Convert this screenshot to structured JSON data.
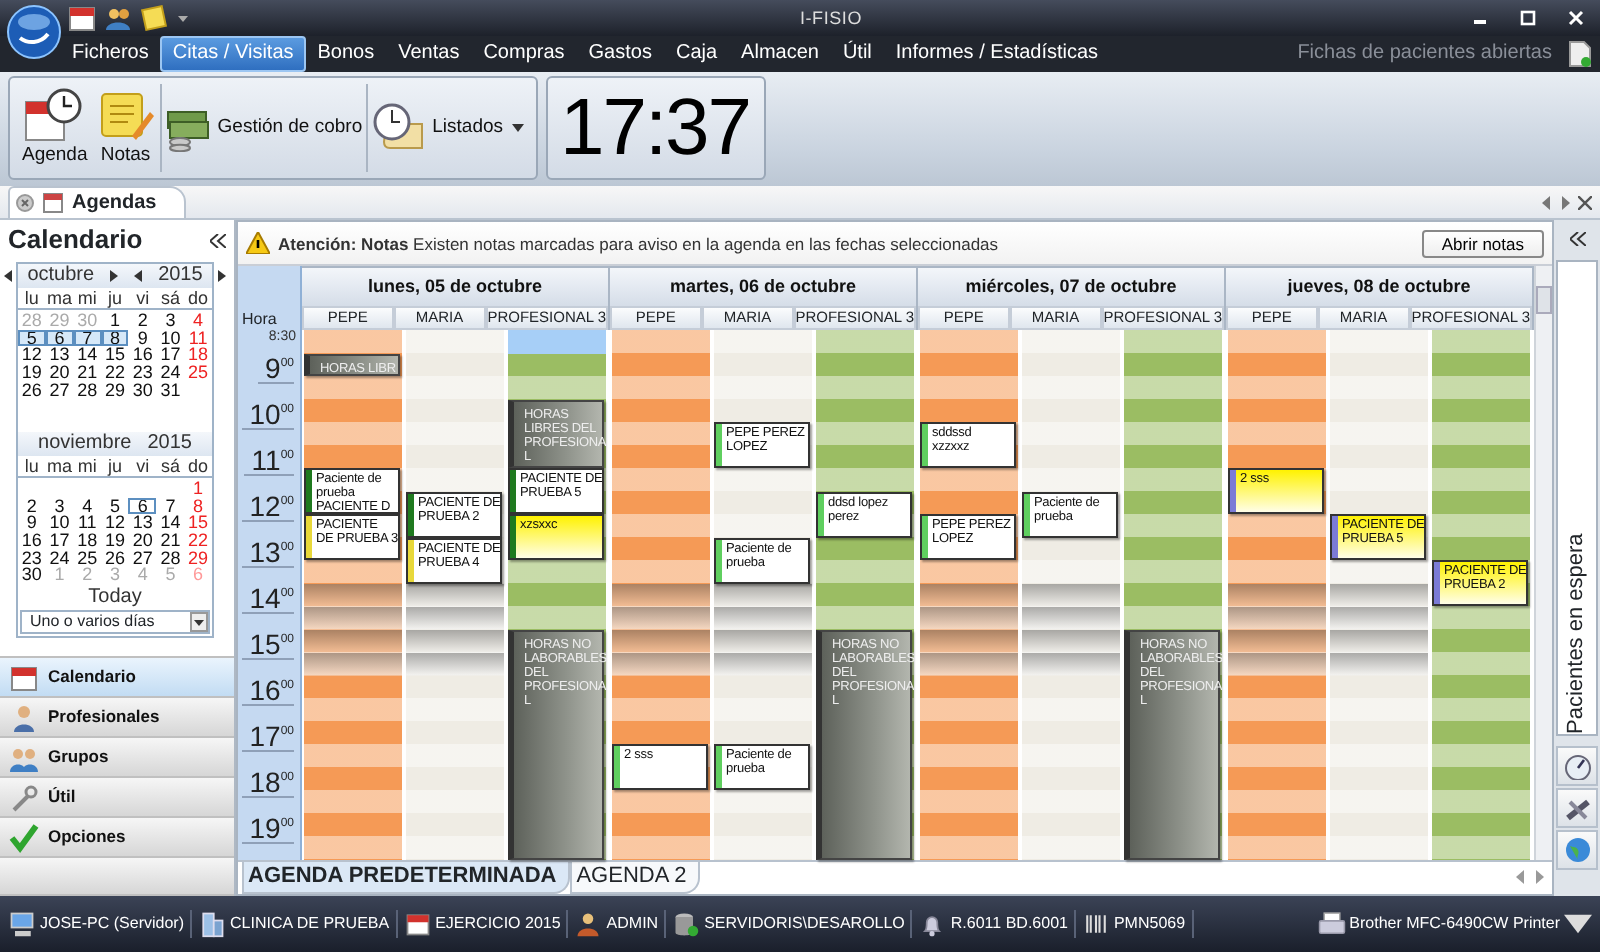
{
  "window": {
    "title": "I-FISIO"
  },
  "menu": [
    {
      "label": "Ficheros",
      "selected": false
    },
    {
      "label": "Citas / Visitas",
      "selected": true
    },
    {
      "label": "Bonos",
      "selected": false
    },
    {
      "label": "Ventas",
      "selected": false
    },
    {
      "label": "Compras",
      "selected": false
    },
    {
      "label": "Gastos",
      "selected": false
    },
    {
      "label": "Caja",
      "selected": false
    },
    {
      "label": "Almacen",
      "selected": false
    },
    {
      "label": "Útil",
      "selected": false
    },
    {
      "label": "Informes / Estadísticas",
      "selected": false
    }
  ],
  "open_records": {
    "label": "Fichas de pacientes abiertas"
  },
  "ribbon": {
    "buttons": [
      {
        "label": "Agenda",
        "kind": "agenda"
      },
      {
        "label": "Notas",
        "kind": "notes"
      },
      {
        "label": "Gestión de cobro",
        "kind": "billing"
      },
      {
        "label": "Listados",
        "kind": "reports"
      }
    ],
    "clock": "17:37"
  },
  "doc_tab": {
    "label": "Agendas"
  },
  "calendar_panel": {
    "title": "Calendario",
    "months": [
      {
        "name": "octubre",
        "year": "2015",
        "arrows": true,
        "weekdays": [
          "lu",
          "ma",
          "mi",
          "ju",
          "vi",
          "sá",
          "do"
        ],
        "days": [
          {
            "kind": "day",
            "d": "28",
            "muted": true,
            "selected": false,
            "today": false
          },
          {
            "kind": "day",
            "d": "29",
            "muted": true,
            "selected": false,
            "today": false
          },
          {
            "kind": "day",
            "d": "30",
            "muted": true,
            "selected": false,
            "today": false
          },
          {
            "kind": "day",
            "d": "1",
            "muted": false,
            "selected": false,
            "today": false
          },
          {
            "kind": "day",
            "d": "2",
            "muted": false,
            "selected": false,
            "today": false
          },
          {
            "kind": "day",
            "d": "3",
            "muted": false,
            "selected": false,
            "today": false
          },
          {
            "kind": "day",
            "d": "4",
            "muted": false,
            "selected": false,
            "today": false
          },
          {
            "kind": "day",
            "d": "5",
            "muted": false,
            "selected": true,
            "today": false
          },
          {
            "kind": "day",
            "d": "6",
            "muted": false,
            "selected": true,
            "today": false
          },
          {
            "kind": "day",
            "d": "7",
            "muted": false,
            "selected": true,
            "today": false
          },
          {
            "kind": "day",
            "d": "8",
            "muted": false,
            "selected": true,
            "today": false
          },
          {
            "kind": "day",
            "d": "9",
            "muted": false,
            "selected": false,
            "today": false
          },
          {
            "kind": "day",
            "d": "10",
            "muted": false,
            "selected": false,
            "today": false
          },
          {
            "kind": "day",
            "d": "11",
            "muted": false,
            "selected": false,
            "today": false
          },
          {
            "kind": "day",
            "d": "12",
            "muted": false,
            "selected": false,
            "today": false
          },
          {
            "kind": "day",
            "d": "13",
            "muted": false,
            "selected": false,
            "today": false
          },
          {
            "kind": "day",
            "d": "14",
            "muted": false,
            "selected": false,
            "today": false
          },
          {
            "kind": "day",
            "d": "15",
            "muted": false,
            "selected": false,
            "today": false
          },
          {
            "kind": "day",
            "d": "16",
            "muted": false,
            "selected": false,
            "today": false
          },
          {
            "kind": "day",
            "d": "17",
            "muted": false,
            "selected": false,
            "today": false
          },
          {
            "kind": "day",
            "d": "18",
            "muted": false,
            "selected": false,
            "today": false
          },
          {
            "kind": "day",
            "d": "19",
            "muted": false,
            "selected": false,
            "today": false
          },
          {
            "kind": "day",
            "d": "20",
            "muted": false,
            "selected": false,
            "today": false
          },
          {
            "kind": "day",
            "d": "21",
            "muted": false,
            "selected": false,
            "today": false
          },
          {
            "kind": "day",
            "d": "22",
            "muted": false,
            "selected": false,
            "today": false
          },
          {
            "kind": "day",
            "d": "23",
            "muted": false,
            "selected": false,
            "today": false
          },
          {
            "kind": "day",
            "d": "24",
            "muted": false,
            "selected": false,
            "today": false
          },
          {
            "kind": "day",
            "d": "25",
            "muted": false,
            "selected": false,
            "today": false
          },
          {
            "kind": "day",
            "d": "26",
            "muted": false,
            "selected": false,
            "today": false
          },
          {
            "kind": "day",
            "d": "27",
            "muted": false,
            "selected": false,
            "today": false
          },
          {
            "kind": "day",
            "d": "28",
            "muted": false,
            "selected": false,
            "today": false
          },
          {
            "kind": "day",
            "d": "29",
            "muted": false,
            "selected": false,
            "today": false
          },
          {
            "kind": "day",
            "d": "30",
            "muted": false,
            "selected": false,
            "today": false
          },
          {
            "kind": "day",
            "d": "31",
            "muted": false,
            "selected": false,
            "today": false
          }
        ]
      },
      {
        "name": "noviembre",
        "year": "2015",
        "arrows": false,
        "weekdays": [
          "lu",
          "ma",
          "mi",
          "ju",
          "vi",
          "sá",
          "do"
        ],
        "days": [
          {
            "kind": "blank"
          },
          {
            "kind": "blank"
          },
          {
            "kind": "blank"
          },
          {
            "kind": "blank"
          },
          {
            "kind": "blank"
          },
          {
            "kind": "blank"
          },
          {
            "kind": "day",
            "d": "1",
            "muted": false,
            "selected": false,
            "today": false
          },
          {
            "kind": "day",
            "d": "2",
            "muted": false,
            "selected": false,
            "today": false
          },
          {
            "kind": "day",
            "d": "3",
            "muted": false,
            "selected": false,
            "today": false
          },
          {
            "kind": "day",
            "d": "4",
            "muted": false,
            "selected": false,
            "today": false
          },
          {
            "kind": "day",
            "d": "5",
            "muted": false,
            "selected": false,
            "today": false
          },
          {
            "kind": "day",
            "d": "6",
            "muted": false,
            "selected": false,
            "today": true
          },
          {
            "kind": "day",
            "d": "7",
            "muted": false,
            "selected": false,
            "today": false
          },
          {
            "kind": "day",
            "d": "8",
            "muted": false,
            "selected": false,
            "today": false
          },
          {
            "kind": "day",
            "d": "9",
            "muted": false,
            "selected": false,
            "today": false
          },
          {
            "kind": "day",
            "d": "10",
            "muted": false,
            "selected": false,
            "today": false
          },
          {
            "kind": "day",
            "d": "11",
            "muted": false,
            "selected": false,
            "today": false
          },
          {
            "kind": "day",
            "d": "12",
            "muted": false,
            "selected": false,
            "today": false
          },
          {
            "kind": "day",
            "d": "13",
            "muted": false,
            "selected": false,
            "today": false
          },
          {
            "kind": "day",
            "d": "14",
            "muted": false,
            "selected": false,
            "today": false
          },
          {
            "kind": "day",
            "d": "15",
            "muted": false,
            "selected": false,
            "today": false
          },
          {
            "kind": "day",
            "d": "16",
            "muted": false,
            "selected": false,
            "today": false
          },
          {
            "kind": "day",
            "d": "17",
            "muted": false,
            "selected": false,
            "today": false
          },
          {
            "kind": "day",
            "d": "18",
            "muted": false,
            "selected": false,
            "today": false
          },
          {
            "kind": "day",
            "d": "19",
            "muted": false,
            "selected": false,
            "today": false
          },
          {
            "kind": "day",
            "d": "20",
            "muted": false,
            "selected": false,
            "today": false
          },
          {
            "kind": "day",
            "d": "21",
            "muted": false,
            "selected": false,
            "today": false
          },
          {
            "kind": "day",
            "d": "22",
            "muted": false,
            "selected": false,
            "today": false
          },
          {
            "kind": "day",
            "d": "23",
            "muted": false,
            "selected": false,
            "today": false
          },
          {
            "kind": "day",
            "d": "24",
            "muted": false,
            "selected": false,
            "today": false
          },
          {
            "kind": "day",
            "d": "25",
            "muted": false,
            "selected": false,
            "today": false
          },
          {
            "kind": "day",
            "d": "26",
            "muted": false,
            "selected": false,
            "today": false
          },
          {
            "kind": "day",
            "d": "27",
            "muted": false,
            "selected": false,
            "today": false
          },
          {
            "kind": "day",
            "d": "28",
            "muted": false,
            "selected": false,
            "today": false
          },
          {
            "kind": "day",
            "d": "29",
            "muted": false,
            "selected": false,
            "today": false
          },
          {
            "kind": "day",
            "d": "30",
            "muted": false,
            "selected": false,
            "today": false
          },
          {
            "kind": "day",
            "d": "1",
            "muted": true,
            "selected": false,
            "today": false
          },
          {
            "kind": "day",
            "d": "2",
            "muted": true,
            "selected": false,
            "today": false
          },
          {
            "kind": "day",
            "d": "3",
            "muted": true,
            "selected": false,
            "today": false
          },
          {
            "kind": "day",
            "d": "4",
            "muted": true,
            "selected": false,
            "today": false
          },
          {
            "kind": "day",
            "d": "5",
            "muted": true,
            "selected": false,
            "today": false
          },
          {
            "kind": "day",
            "d": "6",
            "muted": true,
            "selected": false,
            "today": false
          }
        ]
      }
    ],
    "today_label": "Today",
    "selection_mode": "Uno o varios días"
  },
  "nav": [
    {
      "label": "Calendario",
      "kind": "calendar",
      "selected": true
    },
    {
      "label": "Profesionales",
      "kind": "person",
      "selected": false
    },
    {
      "label": "Grupos",
      "kind": "group",
      "selected": false
    },
    {
      "label": "Útil",
      "kind": "tool",
      "selected": false
    },
    {
      "label": "Opciones",
      "kind": "check",
      "selected": false
    }
  ],
  "notice": {
    "text": "**Atención: Notas** Existen notas marcadas para aviso en la agenda en las fechas seleccionadas",
    "button": "Abrir notas"
  },
  "agenda": {
    "hour_header": "Hora",
    "first_slot": "8:30",
    "hours": [
      {
        "hour": "9",
        "minutes": "00"
      },
      {
        "hour": "10",
        "minutes": "00"
      },
      {
        "hour": "11",
        "minutes": "00"
      },
      {
        "hour": "12",
        "minutes": "00"
      },
      {
        "hour": "13",
        "minutes": "00"
      },
      {
        "hour": "14",
        "minutes": "00"
      },
      {
        "hour": "15",
        "minutes": "00"
      },
      {
        "hour": "16",
        "minutes": "00"
      },
      {
        "hour": "17",
        "minutes": "00"
      },
      {
        "hour": "18",
        "minutes": "00"
      },
      {
        "hour": "19",
        "minutes": "00"
      }
    ],
    "days": [
      {
        "title": "lunes, 05 de octubre",
        "resources": [
          {
            "name": "PEPE",
            "color": "#f59a56",
            "lunch_break": true,
            "slots": [
              {
                "kind": "free"
              },
              {
                "kind": "blocked",
                "text": "HORAS LIBR"
              },
              {
                "kind": "free"
              },
              {
                "kind": "free"
              },
              {
                "kind": "free"
              },
              {
                "kind": "free"
              },
              {
                "kind": "appointment",
                "text": "Paciente de\nprueba\nPACIENTE D",
                "color": "#1f7a1f"
              },
              {
                "kind": "covered"
              },
              {
                "kind": "appointment",
                "text": "PACIENTE\nDE PRUEBA 3",
                "color": "#e8d83a"
              },
              {
                "kind": "covered"
              },
              {
                "kind": "free"
              },
              {
                "kind": "free"
              },
              {
                "kind": "free"
              },
              {
                "kind": "free"
              },
              {
                "kind": "free"
              },
              {
                "kind": "free"
              },
              {
                "kind": "free"
              },
              {
                "kind": "free"
              },
              {
                "kind": "free"
              },
              {
                "kind": "free"
              },
              {
                "kind": "free"
              },
              {
                "kind": "free"
              },
              {
                "kind": "free"
              }
            ]
          },
          {
            "name": "MARIA",
            "color": "#efece4",
            "lunch_break": true,
            "slots": [
              {
                "kind": "free"
              },
              {
                "kind": "free"
              },
              {
                "kind": "free"
              },
              {
                "kind": "free"
              },
              {
                "kind": "free"
              },
              {
                "kind": "free"
              },
              {
                "kind": "free"
              },
              {
                "kind": "appointment",
                "text": "PACIENTE DE\nPRUEBA 2",
                "color": "#1f7a1f"
              },
              {
                "kind": "covered"
              },
              {
                "kind": "appointment",
                "text": "PACIENTE DE\nPRUEBA 4",
                "color": "#e8d83a"
              },
              {
                "kind": "covered"
              },
              {
                "kind": "free"
              },
              {
                "kind": "free"
              },
              {
                "kind": "free"
              },
              {
                "kind": "free"
              },
              {
                "kind": "free"
              },
              {
                "kind": "free"
              },
              {
                "kind": "free"
              },
              {
                "kind": "free"
              },
              {
                "kind": "free"
              },
              {
                "kind": "free"
              },
              {
                "kind": "free"
              },
              {
                "kind": "free"
              }
            ]
          },
          {
            "name": "PROFESIONAL 3",
            "color": "#9bbd63",
            "lunch_break": false,
            "slots": [
              {
                "kind": "selected"
              },
              {
                "kind": "free"
              },
              {
                "kind": "free"
              },
              {
                "kind": "blocked",
                "text": "HORAS\nLIBRES DEL\nPROFESIONA\nL"
              },
              {
                "kind": "covered"
              },
              {
                "kind": "covered"
              },
              {
                "kind": "appointment",
                "text": "PACIENTE DE\nPRUEBA 5",
                "color": "#1f7a1f"
              },
              {
                "kind": "covered"
              },
              {
                "kind": "note",
                "text": "xzsxxc",
                "color": "#1f7a1f"
              },
              {
                "kind": "covered"
              },
              {
                "kind": "free"
              },
              {
                "kind": "free"
              },
              {
                "kind": "free"
              },
              {
                "kind": "blocked",
                "text": "HORAS NO\nLABORABLES\nDEL\nPROFESIONA\nL"
              },
              {
                "kind": "covered"
              },
              {
                "kind": "covered"
              },
              {
                "kind": "covered"
              },
              {
                "kind": "covered"
              },
              {
                "kind": "covered"
              },
              {
                "kind": "covered"
              },
              {
                "kind": "covered"
              },
              {
                "kind": "covered"
              },
              {
                "kind": "covered"
              }
            ]
          }
        ]
      },
      {
        "title": "martes, 06 de octubre",
        "resources": [
          {
            "name": "PEPE",
            "color": "#f59a56",
            "lunch_break": true,
            "slots": [
              {
                "kind": "free"
              },
              {
                "kind": "free"
              },
              {
                "kind": "free"
              },
              {
                "kind": "free"
              },
              {
                "kind": "free"
              },
              {
                "kind": "free"
              },
              {
                "kind": "free"
              },
              {
                "kind": "free"
              },
              {
                "kind": "free"
              },
              {
                "kind": "free"
              },
              {
                "kind": "free"
              },
              {
                "kind": "free"
              },
              {
                "kind": "free"
              },
              {
                "kind": "free"
              },
              {
                "kind": "free"
              },
              {
                "kind": "free"
              },
              {
                "kind": "free"
              },
              {
                "kind": "free"
              },
              {
                "kind": "appointment",
                "text": "2 sss",
                "color": "#5fcf5f"
              },
              {
                "kind": "covered"
              },
              {
                "kind": "free"
              },
              {
                "kind": "free"
              },
              {
                "kind": "free"
              }
            ]
          },
          {
            "name": "MARIA",
            "color": "#efece4",
            "lunch_break": true,
            "slots": [
              {
                "kind": "free"
              },
              {
                "kind": "free"
              },
              {
                "kind": "free"
              },
              {
                "kind": "free"
              },
              {
                "kind": "appointment",
                "text": "PEPE PEREZ\nLOPEZ",
                "color": "#5fcf5f"
              },
              {
                "kind": "covered"
              },
              {
                "kind": "free"
              },
              {
                "kind": "free"
              },
              {
                "kind": "free"
              },
              {
                "kind": "appointment",
                "text": "Paciente de\nprueba",
                "color": "#5fcf5f"
              },
              {
                "kind": "covered"
              },
              {
                "kind": "free"
              },
              {
                "kind": "free"
              },
              {
                "kind": "free"
              },
              {
                "kind": "free"
              },
              {
                "kind": "free"
              },
              {
                "kind": "free"
              },
              {
                "kind": "free"
              },
              {
                "kind": "appointment",
                "text": "Paciente de\nprueba",
                "color": "#5fcf5f"
              },
              {
                "kind": "covered"
              },
              {
                "kind": "free"
              },
              {
                "kind": "free"
              },
              {
                "kind": "free"
              }
            ]
          },
          {
            "name": "PROFESIONAL 3",
            "color": "#9bbd63",
            "lunch_break": false,
            "slots": [
              {
                "kind": "free"
              },
              {
                "kind": "free"
              },
              {
                "kind": "free"
              },
              {
                "kind": "free"
              },
              {
                "kind": "free"
              },
              {
                "kind": "free"
              },
              {
                "kind": "free"
              },
              {
                "kind": "appointment",
                "text": "ddsd lopez\nperez",
                "color": "#5fcf5f"
              },
              {
                "kind": "covered"
              },
              {
                "kind": "free"
              },
              {
                "kind": "free"
              },
              {
                "kind": "free"
              },
              {
                "kind": "free"
              },
              {
                "kind": "blocked",
                "text": "HORAS NO\nLABORABLES\nDEL\nPROFESIONA\nL"
              },
              {
                "kind": "covered"
              },
              {
                "kind": "covered"
              },
              {
                "kind": "covered"
              },
              {
                "kind": "covered"
              },
              {
                "kind": "covered"
              },
              {
                "kind": "covered"
              },
              {
                "kind": "covered"
              },
              {
                "kind": "covered"
              },
              {
                "kind": "covered"
              }
            ]
          }
        ]
      },
      {
        "title": "miércoles, 07 de octubre",
        "resources": [
          {
            "name": "PEPE",
            "color": "#f59a56",
            "lunch_break": true,
            "slots": [
              {
                "kind": "free"
              },
              {
                "kind": "free"
              },
              {
                "kind": "free"
              },
              {
                "kind": "free"
              },
              {
                "kind": "appointment",
                "text": "sddssd\nxzzxxz",
                "color": "#5fcf5f"
              },
              {
                "kind": "covered"
              },
              {
                "kind": "free"
              },
              {
                "kind": "free"
              },
              {
                "kind": "appointment",
                "text": "PEPE PEREZ\nLOPEZ",
                "color": "#5fcf5f"
              },
              {
                "kind": "covered"
              },
              {
                "kind": "free"
              },
              {
                "kind": "free"
              },
              {
                "kind": "free"
              },
              {
                "kind": "free"
              },
              {
                "kind": "free"
              },
              {
                "kind": "free"
              },
              {
                "kind": "free"
              },
              {
                "kind": "free"
              },
              {
                "kind": "free"
              },
              {
                "kind": "free"
              },
              {
                "kind": "free"
              },
              {
                "kind": "free"
              },
              {
                "kind": "free"
              }
            ]
          },
          {
            "name": "MARIA",
            "color": "#efece4",
            "lunch_break": true,
            "slots": [
              {
                "kind": "free"
              },
              {
                "kind": "free"
              },
              {
                "kind": "free"
              },
              {
                "kind": "free"
              },
              {
                "kind": "free"
              },
              {
                "kind": "free"
              },
              {
                "kind": "free"
              },
              {
                "kind": "appointment",
                "text": "Paciente de\nprueba",
                "color": "#5fcf5f"
              },
              {
                "kind": "covered"
              },
              {
                "kind": "free"
              },
              {
                "kind": "free"
              },
              {
                "kind": "free"
              },
              {
                "kind": "free"
              },
              {
                "kind": "free"
              },
              {
                "kind": "free"
              },
              {
                "kind": "free"
              },
              {
                "kind": "free"
              },
              {
                "kind": "free"
              },
              {
                "kind": "free"
              },
              {
                "kind": "free"
              },
              {
                "kind": "free"
              },
              {
                "kind": "free"
              },
              {
                "kind": "free"
              }
            ]
          },
          {
            "name": "PROFESIONAL 3",
            "color": "#9bbd63",
            "lunch_break": false,
            "slots": [
              {
                "kind": "free"
              },
              {
                "kind": "free"
              },
              {
                "kind": "free"
              },
              {
                "kind": "free"
              },
              {
                "kind": "free"
              },
              {
                "kind": "free"
              },
              {
                "kind": "free"
              },
              {
                "kind": "free"
              },
              {
                "kind": "free"
              },
              {
                "kind": "free"
              },
              {
                "kind": "free"
              },
              {
                "kind": "free"
              },
              {
                "kind": "free"
              },
              {
                "kind": "blocked",
                "text": "HORAS NO\nLABORABLES\nDEL\nPROFESIONA\nL"
              },
              {
                "kind": "covered"
              },
              {
                "kind": "covered"
              },
              {
                "kind": "covered"
              },
              {
                "kind": "covered"
              },
              {
                "kind": "covered"
              },
              {
                "kind": "covered"
              },
              {
                "kind": "covered"
              },
              {
                "kind": "covered"
              },
              {
                "kind": "covered"
              }
            ]
          }
        ]
      },
      {
        "title": "jueves, 08 de octubre",
        "resources": [
          {
            "name": "PEPE",
            "color": "#f59a56",
            "lunch_break": true,
            "slots": [
              {
                "kind": "free"
              },
              {
                "kind": "free"
              },
              {
                "kind": "free"
              },
              {
                "kind": "free"
              },
              {
                "kind": "free"
              },
              {
                "kind": "free"
              },
              {
                "kind": "note",
                "text": "2 sss",
                "color": "#7b7bd6"
              },
              {
                "kind": "covered"
              },
              {
                "kind": "free"
              },
              {
                "kind": "free"
              },
              {
                "kind": "free"
              },
              {
                "kind": "free"
              },
              {
                "kind": "free"
              },
              {
                "kind": "free"
              },
              {
                "kind": "free"
              },
              {
                "kind": "free"
              },
              {
                "kind": "free"
              },
              {
                "kind": "free"
              },
              {
                "kind": "free"
              },
              {
                "kind": "free"
              },
              {
                "kind": "free"
              },
              {
                "kind": "free"
              },
              {
                "kind": "free"
              }
            ]
          },
          {
            "name": "MARIA",
            "color": "#efece4",
            "lunch_break": true,
            "slots": [
              {
                "kind": "free"
              },
              {
                "kind": "free"
              },
              {
                "kind": "free"
              },
              {
                "kind": "free"
              },
              {
                "kind": "free"
              },
              {
                "kind": "free"
              },
              {
                "kind": "free"
              },
              {
                "kind": "free"
              },
              {
                "kind": "note",
                "text": "PACIENTE DE\nPRUEBA 5",
                "color": "#7b7bd6"
              },
              {
                "kind": "covered"
              },
              {
                "kind": "free"
              },
              {
                "kind": "free"
              },
              {
                "kind": "free"
              },
              {
                "kind": "free"
              },
              {
                "kind": "free"
              },
              {
                "kind": "free"
              },
              {
                "kind": "free"
              },
              {
                "kind": "free"
              },
              {
                "kind": "free"
              },
              {
                "kind": "free"
              },
              {
                "kind": "free"
              },
              {
                "kind": "free"
              },
              {
                "kind": "free"
              }
            ]
          },
          {
            "name": "PROFESIONAL 3",
            "color": "#9bbd63",
            "lunch_break": false,
            "slots": [
              {
                "kind": "free"
              },
              {
                "kind": "free"
              },
              {
                "kind": "free"
              },
              {
                "kind": "free"
              },
              {
                "kind": "free"
              },
              {
                "kind": "free"
              },
              {
                "kind": "free"
              },
              {
                "kind": "free"
              },
              {
                "kind": "free"
              },
              {
                "kind": "free"
              },
              {
                "kind": "note",
                "text": "PACIENTE DE\nPRUEBA 2",
                "color": "#7b7bd6"
              },
              {
                "kind": "covered"
              },
              {
                "kind": "free"
              },
              {
                "kind": "free"
              },
              {
                "kind": "free"
              },
              {
                "kind": "free"
              },
              {
                "kind": "free"
              },
              {
                "kind": "free"
              },
              {
                "kind": "free"
              },
              {
                "kind": "free"
              },
              {
                "kind": "free"
              },
              {
                "kind": "free"
              },
              {
                "kind": "free"
              }
            ]
          }
        ]
      }
    ]
  },
  "agenda_tabs": [
    {
      "label": "AGENDA PREDETERMINADA",
      "selected": true
    },
    {
      "label": "AGENDA 2",
      "selected": false
    }
  ],
  "waiting_panel": {
    "title": "Pacientes en espera"
  },
  "status_bar": [
    {
      "label": "JOSE-PC (Servidor)",
      "kind": "computer"
    },
    {
      "label": "CLINICA DE PRUEBA",
      "kind": "building"
    },
    {
      "label": "EJERCICIO 2015",
      "kind": "calendar"
    },
    {
      "label": "ADMIN",
      "kind": "user"
    },
    {
      "label": "SERVIDORIS\\DESAROLLO",
      "kind": "database"
    },
    {
      "label": "R.6011 BD.6001",
      "kind": "update"
    },
    {
      "label": "PMN5069",
      "kind": "barcode"
    }
  ],
  "printer": {
    "label": "Brother MFC-6490CW Printer"
  }
}
